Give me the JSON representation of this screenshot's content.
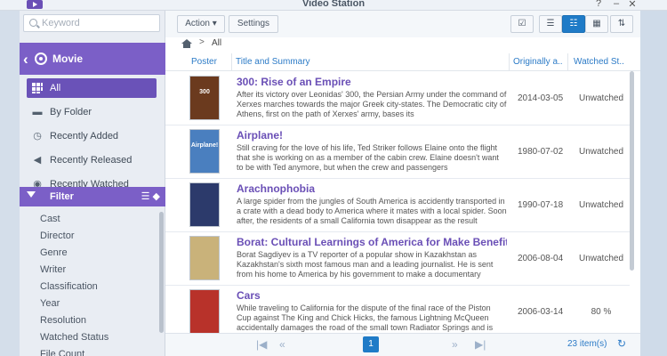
{
  "window": {
    "title": "Video Station",
    "help_label": "?",
    "minimize_label": "–",
    "close_label": "✕"
  },
  "search": {
    "placeholder": "Keyword",
    "value": ""
  },
  "library": {
    "title": "Movie"
  },
  "nav": [
    {
      "label": "All",
      "icon": "grid-icon",
      "active": true
    },
    {
      "label": "By Folder",
      "icon": "folder-icon"
    },
    {
      "label": "Recently Added",
      "icon": "clock-plus-icon"
    },
    {
      "label": "Recently Released",
      "icon": "megaphone-icon"
    },
    {
      "label": "Recently Watched",
      "icon": "eye-icon"
    }
  ],
  "filter": {
    "title": "Filter",
    "items": [
      "Cast",
      "Director",
      "Genre",
      "Writer",
      "Classification",
      "Year",
      "Resolution",
      "Watched Status",
      "File Count"
    ]
  },
  "toolbar": {
    "action_label": "Action ▾",
    "settings_label": "Settings",
    "selected_view": "detail-list"
  },
  "breadcrumb": {
    "current": "All",
    "separator": ">"
  },
  "table": {
    "columns": [
      "Poster",
      "Title and Summary",
      "Originally a...",
      "Watched St..."
    ],
    "rows": [
      {
        "poster_text": "300",
        "poster_color": "#6b3a1e",
        "title": "300: Rise of an Empire",
        "summary": "After its victory over Leonidas' 300, the Persian Army under the command of Xerxes marches towards the major Greek city-states. The Democratic city of Athens, first on the path of Xerxes' army, bases its",
        "date": "2014-03-05",
        "watched": "Unwatched"
      },
      {
        "poster_text": "Airplane!",
        "poster_color": "#4a7fbf",
        "title": "Airplane!",
        "summary": "Still craving for the love of his life, Ted Striker follows Elaine onto the flight that she is working on as a member of the cabin crew. Elaine doesn't want to be with Ted anymore, but when the crew and passengers",
        "date": "1980-07-02",
        "watched": "Unwatched"
      },
      {
        "poster_text": "",
        "poster_color": "#2c3a6b",
        "title": "Arachnophobia",
        "summary": "A large spider from the jungles of South America is accidently transported in a crate with a dead body to America where it mates with a local spider. Soon after, the residents of a small California town disappear as the result",
        "date": "1990-07-18",
        "watched": "Unwatched"
      },
      {
        "poster_text": "",
        "poster_color": "#c9b27a",
        "title": "Borat: Cultural Learnings of America for Make Benefit",
        "summary": "Borat Sagdiyev is a TV reporter of a popular show in Kazakhstan as Kazakhstan's sixth most famous man and a leading journalist. He is sent from his home to America by his government to make a documentary",
        "date": "2006-08-04",
        "watched": "Unwatched"
      },
      {
        "poster_text": "",
        "poster_color": "#b8322a",
        "title": "Cars",
        "summary": "While traveling to California for the dispute of the final race of the Piston Cup against The King and Chick Hicks, the famous Lightning McQueen accidentally damages the road of the small town Radiator Springs and is",
        "date": "2006-03-14",
        "watched": "80 %"
      }
    ]
  },
  "pagination": {
    "current_page": "1",
    "total": "23 item(s)"
  }
}
